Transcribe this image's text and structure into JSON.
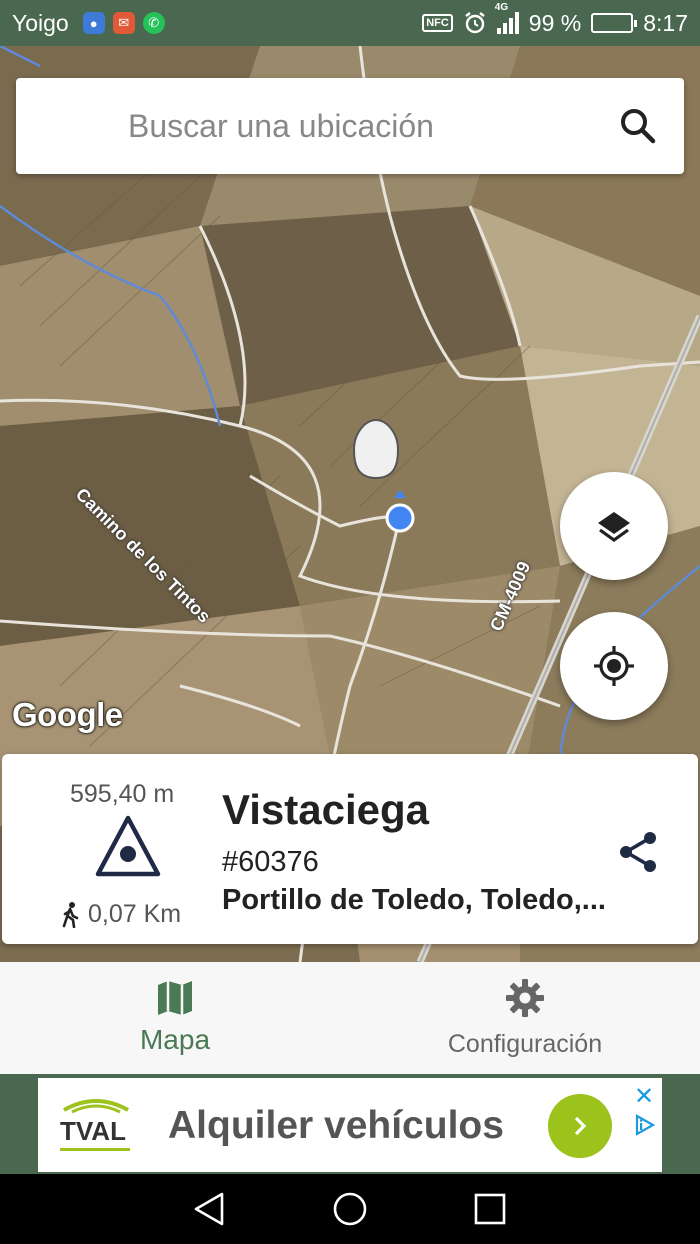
{
  "status_bar": {
    "carrier": "Yoigo",
    "nfc_label": "NFC",
    "network": "4G",
    "battery": "99 %",
    "battery_level": 0.99,
    "time": "8:17",
    "icons": [
      "location-icon",
      "mail-icon",
      "whatsapp-icon",
      "nfc-icon",
      "alarm-icon",
      "signal-icon",
      "battery-icon"
    ]
  },
  "search": {
    "placeholder": "Buscar una ubicación",
    "icon": "search-icon"
  },
  "map": {
    "road_labels": [
      "Camino de los Tintos",
      "CM-4009"
    ],
    "attribution": "Google",
    "markers": [
      "pin-marker",
      "current-location-dot"
    ],
    "buttons": [
      "layers-icon",
      "my-location-icon"
    ]
  },
  "info_card": {
    "elevation": "595,40 m",
    "distance": "0,07 Km",
    "title": "Vistaciega",
    "id": "#60376",
    "location": "Portillo de Toledo, Toledo,...",
    "share_icon": "share-icon"
  },
  "bottom_nav": {
    "tabs": [
      {
        "label": "Mapa",
        "icon": "map-icon",
        "active": true
      },
      {
        "label": "Configuración",
        "icon": "gear-icon",
        "active": false
      }
    ]
  },
  "ad": {
    "brand": "TVAL",
    "text": "Alquiler vehículos"
  },
  "colors": {
    "brand": "#4a6750",
    "active_tab": "#4a7a55",
    "ad_button": "#9bc31b",
    "location_dot": "#4285f4"
  }
}
